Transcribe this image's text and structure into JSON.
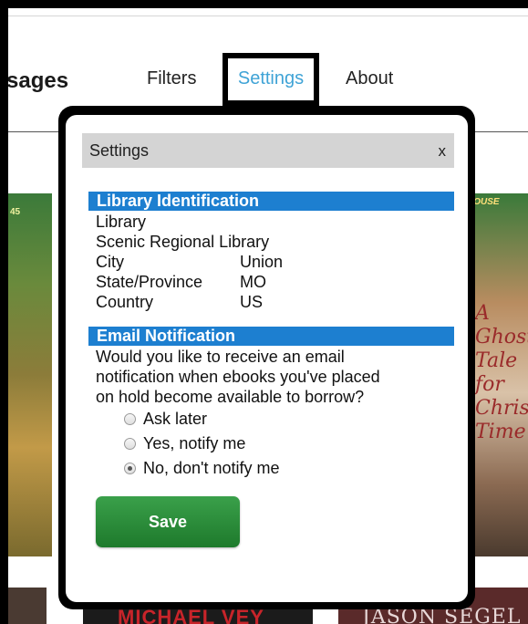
{
  "header": {
    "page_title_fragment": "sages",
    "nav": {
      "filters": "Filters",
      "settings": "Settings",
      "about": "About"
    }
  },
  "background_covers": {
    "left_number": "45",
    "right_title": "HOUSE",
    "right_script": "A Ghost Tale for Christmas Time",
    "bottom_center": "MICHAEL VEY",
    "bottom_right": "JASON SEGEL"
  },
  "settings_popup": {
    "title": "Settings",
    "close_label": "x",
    "library_section": {
      "heading": "Library Identification",
      "library_label": "Library",
      "library_name": "Scenic Regional Library",
      "city_label": "City",
      "city_value": "Union",
      "state_label": "State/Province",
      "state_value": "MO",
      "country_label": "Country",
      "country_value": "US"
    },
    "email_section": {
      "heading": "Email Notification",
      "question_line1": "Would you like to receive an email",
      "question_line2": "notification when ebooks you've placed",
      "question_line3": "on hold become available to borrow?",
      "options": [
        {
          "label": "Ask later",
          "checked": false
        },
        {
          "label": "Yes, notify me",
          "checked": false
        },
        {
          "label": "No, don't notify me",
          "checked": true
        }
      ]
    },
    "save_label": "Save"
  },
  "colors": {
    "section_bar": "#1d7fd0",
    "nav_active": "#3fa3d6",
    "save_button": "#2a8c3a"
  }
}
